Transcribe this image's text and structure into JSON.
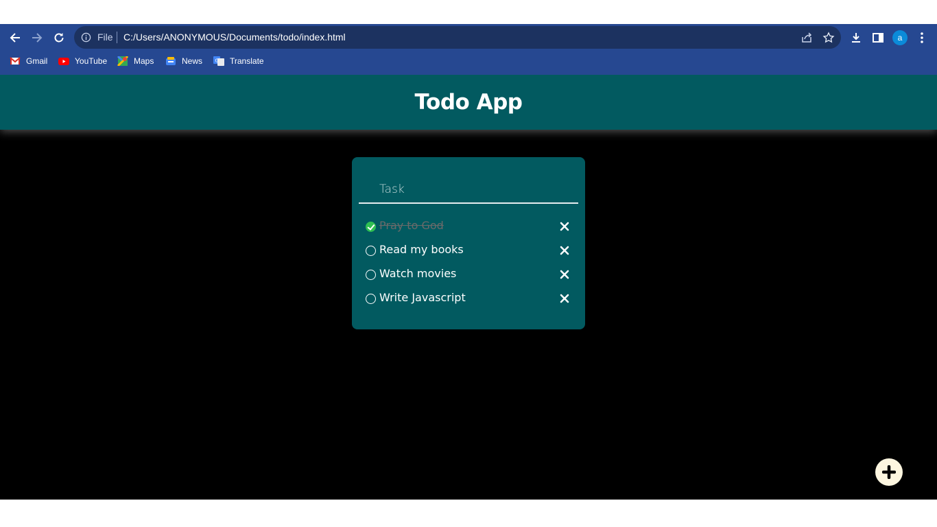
{
  "browser": {
    "address_scheme": "File",
    "url": "C:/Users/ANONYMOUS/Documents/todo/index.html",
    "profile_initial": "a",
    "bookmarks": [
      {
        "label": "Gmail",
        "icon": "gmail-icon"
      },
      {
        "label": "YouTube",
        "icon": "youtube-icon"
      },
      {
        "label": "Maps",
        "icon": "maps-icon"
      },
      {
        "label": "News",
        "icon": "news-icon"
      },
      {
        "label": "Translate",
        "icon": "translate-icon"
      }
    ]
  },
  "app": {
    "title": "Todo App",
    "input_placeholder": "Task",
    "input_value": "",
    "todos": [
      {
        "text": "Pray to God",
        "completed": true
      },
      {
        "text": "Read my books",
        "completed": false
      },
      {
        "text": "Watch movies",
        "completed": false
      },
      {
        "text": "Write Javascript",
        "completed": false
      }
    ],
    "delete_icon": "close-icon",
    "add_icon": "plus-icon"
  },
  "colors": {
    "browser_chrome": "#264891",
    "app_teal": "#025a60",
    "page_background": "#000000",
    "completed_check": "#2fbf52",
    "add_button": "#fdf6e0"
  }
}
